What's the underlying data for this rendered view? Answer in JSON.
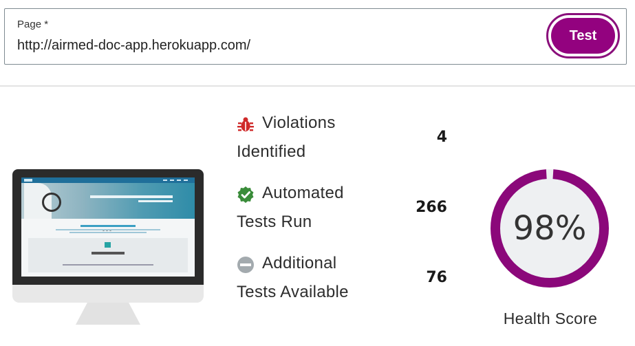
{
  "form": {
    "label": "Page *",
    "url": "http://airmed-doc-app.herokuapp.com/",
    "test_button": "Test"
  },
  "stats": [
    {
      "line1": "Violations",
      "line2": "Identified",
      "value": "4",
      "icon": "bug-icon",
      "color": "#cf2a2a"
    },
    {
      "line1": "Automated",
      "line2": "Tests Run",
      "value": "266",
      "icon": "check-badge-icon",
      "color": "#3a8c3a"
    },
    {
      "line1": "Additional",
      "line2": "Tests Available",
      "value": "76",
      "icon": "minus-circle-icon",
      "color": "#a3aaae"
    }
  ],
  "health": {
    "score": 98,
    "display": "98%",
    "label": "Health Score",
    "color": "#8b087a"
  },
  "colors": {
    "accent": "#93027f",
    "track": "#eef0f2"
  }
}
